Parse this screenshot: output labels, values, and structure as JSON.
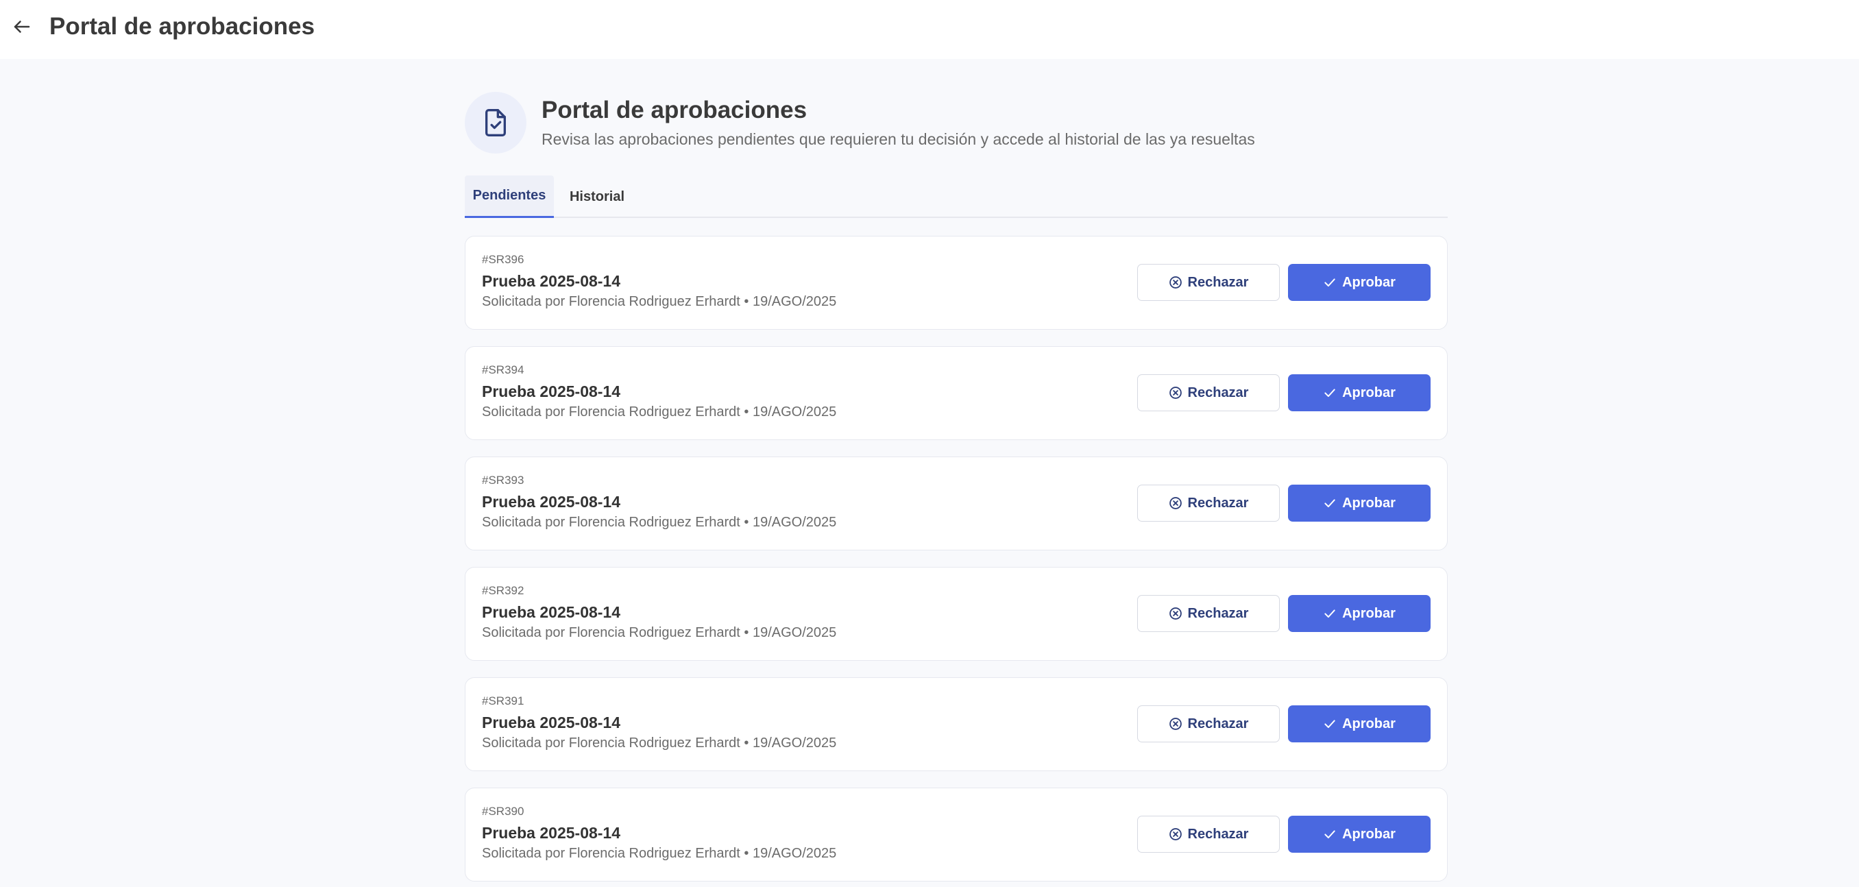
{
  "topbar": {
    "title": "Portal de aprobaciones",
    "back_icon": "arrow-left-icon"
  },
  "header": {
    "icon": "document-check-icon",
    "title": "Portal de aprobaciones",
    "subtitle": "Revisa las aprobaciones pendientes que requieren tu decisión y accede al historial de las ya resueltas"
  },
  "tabs": [
    {
      "label": "Pendientes",
      "active": true
    },
    {
      "label": "Historial",
      "active": false
    }
  ],
  "colors": {
    "accent": "#4a68e0",
    "accent_dark": "#2e3f7a",
    "background": "#f8f9fc"
  },
  "actions": {
    "reject_label": "Rechazar",
    "reject_icon": "x-circle-icon",
    "approve_label": "Aprobar",
    "approve_icon": "check-icon"
  },
  "requests": [
    {
      "id": "#SR396",
      "title": "Prueba 2025-08-14",
      "meta": "Solicitada por Florencia Rodriguez Erhardt • 19/AGO/2025"
    },
    {
      "id": "#SR394",
      "title": "Prueba 2025-08-14",
      "meta": "Solicitada por Florencia Rodriguez Erhardt • 19/AGO/2025"
    },
    {
      "id": "#SR393",
      "title": "Prueba 2025-08-14",
      "meta": "Solicitada por Florencia Rodriguez Erhardt • 19/AGO/2025"
    },
    {
      "id": "#SR392",
      "title": "Prueba 2025-08-14",
      "meta": "Solicitada por Florencia Rodriguez Erhardt • 19/AGO/2025"
    },
    {
      "id": "#SR391",
      "title": "Prueba 2025-08-14",
      "meta": "Solicitada por Florencia Rodriguez Erhardt • 19/AGO/2025"
    },
    {
      "id": "#SR390",
      "title": "Prueba 2025-08-14",
      "meta": "Solicitada por Florencia Rodriguez Erhardt • 19/AGO/2025"
    }
  ]
}
